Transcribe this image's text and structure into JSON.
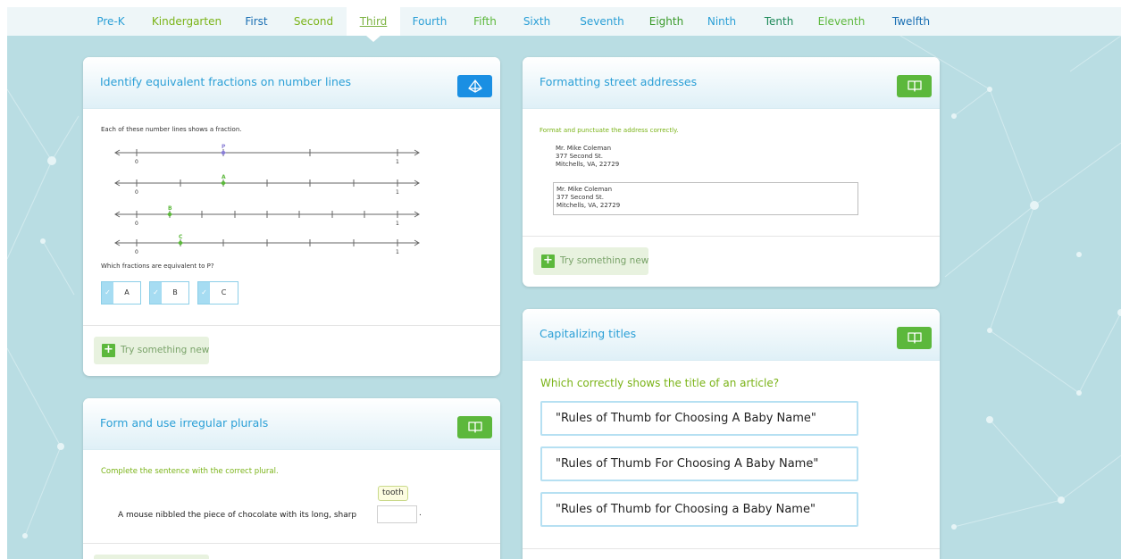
{
  "nav": {
    "grades": [
      {
        "label": "Pre-K",
        "color": "#2a9fd6"
      },
      {
        "label": "Kindergarten",
        "color": "#7ab317"
      },
      {
        "label": "First",
        "color": "#1a6fb3"
      },
      {
        "label": "Second",
        "color": "#7ab317"
      },
      {
        "label": "Third",
        "color": "#7cb342"
      },
      {
        "label": "Fourth",
        "color": "#2a9fd6"
      },
      {
        "label": "Fifth",
        "color": "#5cb83c"
      },
      {
        "label": "Sixth",
        "color": "#2a9fd6"
      },
      {
        "label": "Seventh",
        "color": "#2a9fd6"
      },
      {
        "label": "Eighth",
        "color": "#3a9a2a"
      },
      {
        "label": "Ninth",
        "color": "#2a9fd6"
      },
      {
        "label": "Tenth",
        "color": "#1f8a5a"
      },
      {
        "label": "Eleventh",
        "color": "#5cb83c"
      },
      {
        "label": "Twelfth",
        "color": "#1a6fb3"
      }
    ],
    "active": "Third"
  },
  "cards": {
    "fractions": {
      "title": "Identify equivalent fractions on number lines",
      "icon": "pyramid-icon",
      "intro": "Each of these number lines shows a fraction.",
      "lines": [
        {
          "point_label": "P",
          "start": "0",
          "end": "1",
          "color": "#8a7fd6"
        },
        {
          "point_label": "A",
          "start": "0",
          "end": "1",
          "color": "#5cb83c"
        },
        {
          "point_label": "B",
          "start": "0",
          "end": "1",
          "color": "#5cb83c"
        },
        {
          "point_label": "C",
          "start": "0",
          "end": "1",
          "color": "#5cb83c"
        }
      ],
      "question": "Which fractions are equivalent to P?",
      "choices": [
        "A",
        "B",
        "C"
      ],
      "try_label": "Try something new"
    },
    "plurals": {
      "title": "Form and use irregular plurals",
      "icon": "book-icon",
      "instruction": "Complete the sentence with the correct plural.",
      "hint": "tooth",
      "sentence": "A mouse nibbled the piece of chocolate with its long, sharp",
      "period": "."
    },
    "addresses": {
      "title": "Formatting street addresses",
      "icon": "book-icon",
      "instruction": "Format and punctuate the address correctly.",
      "address": [
        "Mr. Mike Coleman",
        "377 Second St.",
        "Mitchells, VA, 22729"
      ],
      "answer": [
        "Mr. Mike Coleman",
        "377 Second St.",
        "Mitchells, VA, 22729"
      ],
      "try_label": "Try something new"
    },
    "titles": {
      "title": "Capitalizing titles",
      "icon": "book-icon",
      "question": "Which correctly shows the title of an article?",
      "options": [
        "\"Rules of Thumb for Choosing A Baby Name\"",
        "\"Rules of Thumb For Choosing A Baby Name\"",
        "\"Rules of Thumb for Choosing a Baby Name\""
      ]
    }
  }
}
